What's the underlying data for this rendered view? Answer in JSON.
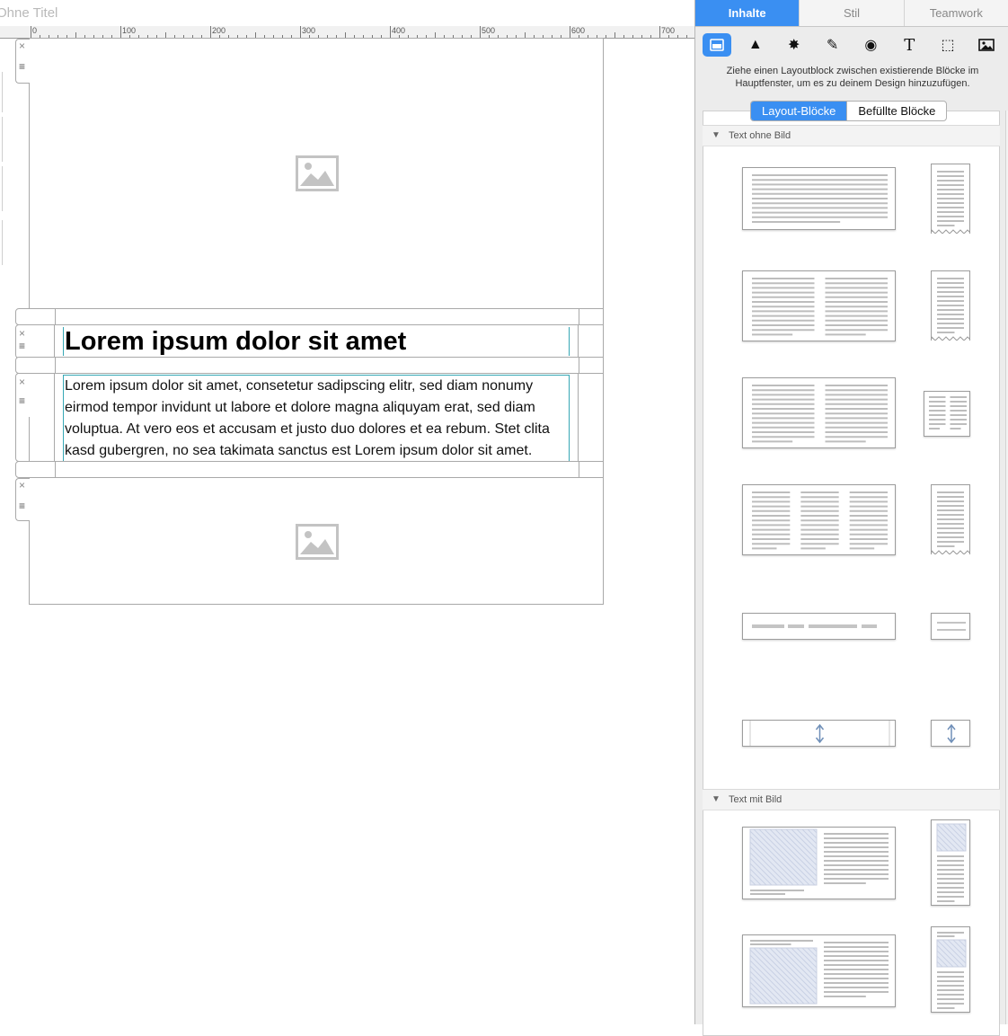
{
  "document": {
    "title": "Ohne Titel"
  },
  "ruler": {
    "labels": [
      "0",
      "100",
      "200",
      "300",
      "400",
      "500",
      "600",
      "700"
    ]
  },
  "content": {
    "heading": "Lorem ipsum dolor sit amet",
    "paragraph": "Lorem ipsum dolor sit amet, consetetur sadipscing elitr, sed diam nonumy eirmod tempor invidunt ut labore et dolore magna aliquyam erat, sed diam voluptua. At vero eos et accusam et justo duo dolores et ea rebum. Stet clita kasd gubergren, no sea takimata sanctus est Lorem ipsum dolor sit amet."
  },
  "handles": {
    "close": "×",
    "menu": "≡"
  },
  "sidebar": {
    "tabs": [
      {
        "label": "Inhalte",
        "active": true
      },
      {
        "label": "Stil",
        "active": false
      },
      {
        "label": "Teamwork",
        "active": false
      }
    ],
    "tools": [
      {
        "icon": "layout-blocks-icon",
        "glyph": "",
        "active": true
      },
      {
        "icon": "shape-icon",
        "glyph": "▲",
        "active": false
      },
      {
        "icon": "badge-icon",
        "glyph": "✸",
        "active": false
      },
      {
        "icon": "brush-icon",
        "glyph": "✎",
        "active": false
      },
      {
        "icon": "video-icon",
        "glyph": "◉",
        "active": false
      },
      {
        "icon": "text-icon",
        "glyph": "T",
        "active": false
      },
      {
        "icon": "selection-icon",
        "glyph": "⬚",
        "active": false
      },
      {
        "icon": "image-icon",
        "glyph": "",
        "active": false
      }
    ],
    "hint": "Ziehe einen Layoutblock zwischen existierende Blöcke im Hauptfenster, um es zu deinem Design hinzuzufügen.",
    "segment": {
      "layout": "Layout-Blöcke",
      "filled": "Befüllte Blöcke"
    },
    "sections": {
      "text_only": "Text ohne Bild",
      "text_image": "Text mit Bild"
    },
    "collapse_glyph": "▼"
  },
  "colors": {
    "accent": "#3a8ff2",
    "frame": "#36a7b5",
    "placeholder": "#bdbdbd"
  }
}
